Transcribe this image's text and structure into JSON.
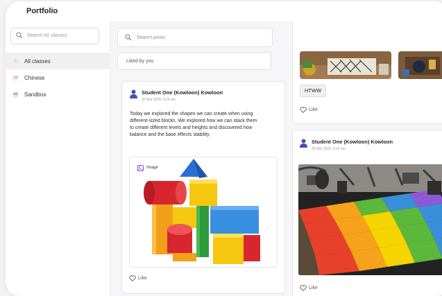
{
  "app": {
    "title": "Portfolio"
  },
  "sidebar": {
    "search_placeholder": "Search for classes",
    "classes": [
      {
        "label": "All classes",
        "badge": "≡",
        "color": "#b0b0b8",
        "bg": "#f0f0f3"
      },
      {
        "label": "Chinese",
        "badge": "cn",
        "color": "#e57d9c",
        "bg": "#fde8ef"
      },
      {
        "label": "Sandbox",
        "badge": "sb",
        "color": "#6f7ee0",
        "bg": "#e4e7fb"
      }
    ]
  },
  "main": {
    "search_placeholder": "Search posts",
    "filter_label": "Liked by you",
    "posts": [
      {
        "author": "Student One (Kowloon) Kowloon",
        "date": "30 Mar 2025, 9:16 am",
        "text": "Today we explored the shapes we can create when using different-sized blocks. We explored how we can stack them to create different levels and heights and discovered how balance and the base effects stability.",
        "media_label": "Image",
        "like_label": "Like"
      },
      {
        "tag": "HTWW",
        "like_label": "Like"
      },
      {
        "author": "Student One (Kowloon) Kowloon",
        "date": "30 Mar 2025, 9:16 am",
        "like_label": "Like"
      }
    ]
  },
  "icons": {
    "search": "search-icon",
    "avatar": "student-avatar-icon",
    "image": "image-icon",
    "like": "heart-icon"
  },
  "colors": {
    "accent": "#3f51b5",
    "carpet": [
      "#e8412b",
      "#f7a21c",
      "#f5d400",
      "#5cb83a",
      "#3a8fd9",
      "#8c5bd3"
    ]
  }
}
